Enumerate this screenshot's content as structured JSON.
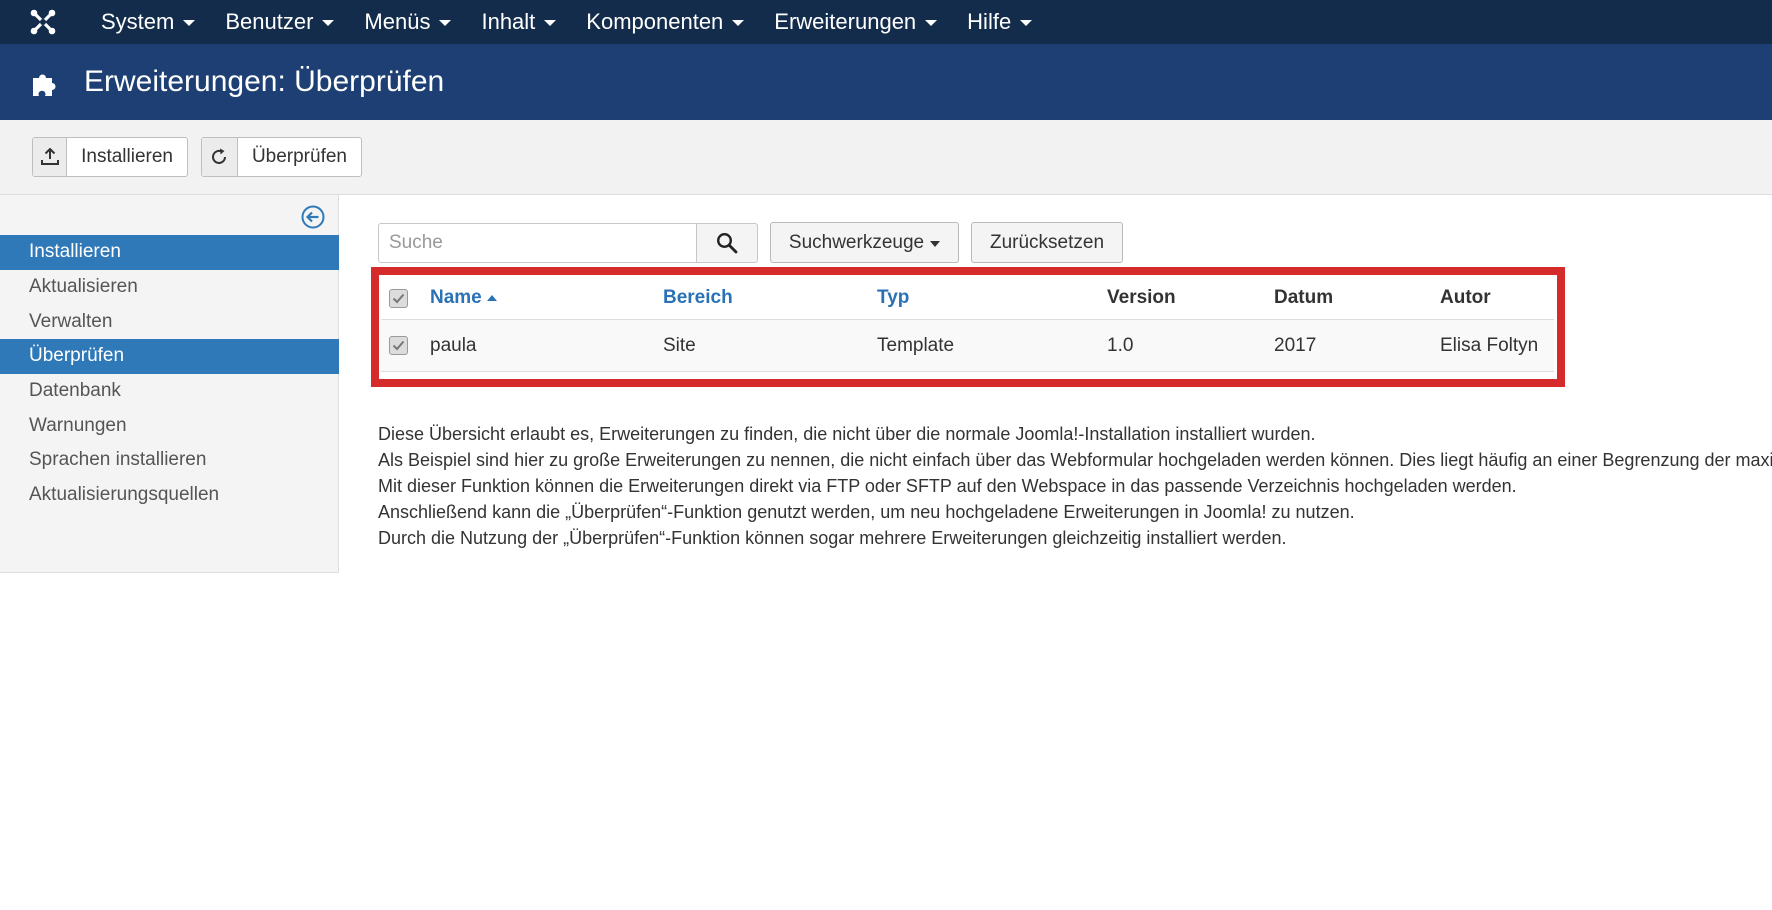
{
  "topnav": {
    "items": [
      {
        "label": "System"
      },
      {
        "label": "Benutzer"
      },
      {
        "label": "Menüs"
      },
      {
        "label": "Inhalt"
      },
      {
        "label": "Komponenten"
      },
      {
        "label": "Erweiterungen"
      },
      {
        "label": "Hilfe"
      }
    ]
  },
  "header": {
    "title": "Erweiterungen: Überprüfen",
    "icon": "puzzle-icon"
  },
  "toolbar": {
    "install_label": "Installieren",
    "discover_label": "Überprüfen"
  },
  "sidebar": {
    "items": [
      {
        "label": "Installieren",
        "active": true
      },
      {
        "label": "Aktualisieren",
        "active": false
      },
      {
        "label": "Verwalten",
        "active": false
      },
      {
        "label": "Überprüfen",
        "active": true
      },
      {
        "label": "Datenbank",
        "active": false
      },
      {
        "label": "Warnungen",
        "active": false
      },
      {
        "label": "Sprachen installieren",
        "active": false
      },
      {
        "label": "Aktualisierungsquellen",
        "active": false
      }
    ]
  },
  "filters": {
    "search_placeholder": "Suche",
    "tools_label": "Suchwerkzeuge",
    "reset_label": "Zurücksetzen"
  },
  "table": {
    "columns": [
      "Name",
      "Bereich",
      "Typ",
      "Version",
      "Datum",
      "Autor"
    ],
    "rows": [
      {
        "name": "paula",
        "area": "Site",
        "type": "Template",
        "version": "1.0",
        "date": "2017",
        "author": "Elisa Foltyn"
      }
    ]
  },
  "description": {
    "lines": [
      "Diese Übersicht erlaubt es, Erweiterungen zu finden, die nicht über die normale Joomla!-Installation installiert wurden.",
      "Als Beispiel sind hier zu große Erweiterungen zu nennen, die nicht einfach über das Webformular hochgeladen werden können. Dies liegt häufig an einer Begrenzung der maximalen Dateigröße des Servers.",
      "Mit dieser Funktion können die Erweiterungen direkt via FTP oder SFTP auf den Webspace in das passende Verzeichnis hochgeladen werden.",
      "Anschließend kann die „Überprüfen“-Funktion genutzt werden, um neu hochgeladene Erweiterungen in Joomla! zu nutzen.",
      "Durch die Nutzung der „Überprüfen“-Funktion können sogar mehrere Erweiterungen gleichzeitig installiert werden."
    ]
  },
  "colors": {
    "topnav": "#132c4c",
    "header": "#1d3f73",
    "active": "#2f79b8",
    "link": "#2a72b5",
    "highlight": "#d52b2b"
  }
}
